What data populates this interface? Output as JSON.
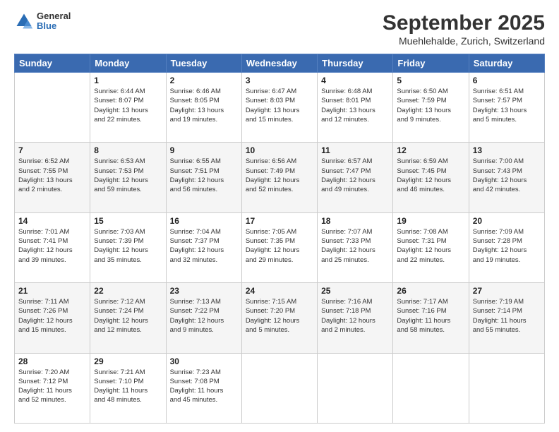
{
  "header": {
    "logo_general": "General",
    "logo_blue": "Blue",
    "title": "September 2025",
    "subtitle": "Muehlehalde, Zurich, Switzerland"
  },
  "days_of_week": [
    "Sunday",
    "Monday",
    "Tuesday",
    "Wednesday",
    "Thursday",
    "Friday",
    "Saturday"
  ],
  "weeks": [
    [
      {
        "day": "",
        "info": ""
      },
      {
        "day": "1",
        "info": "Sunrise: 6:44 AM\nSunset: 8:07 PM\nDaylight: 13 hours\nand 22 minutes."
      },
      {
        "day": "2",
        "info": "Sunrise: 6:46 AM\nSunset: 8:05 PM\nDaylight: 13 hours\nand 19 minutes."
      },
      {
        "day": "3",
        "info": "Sunrise: 6:47 AM\nSunset: 8:03 PM\nDaylight: 13 hours\nand 15 minutes."
      },
      {
        "day": "4",
        "info": "Sunrise: 6:48 AM\nSunset: 8:01 PM\nDaylight: 13 hours\nand 12 minutes."
      },
      {
        "day": "5",
        "info": "Sunrise: 6:50 AM\nSunset: 7:59 PM\nDaylight: 13 hours\nand 9 minutes."
      },
      {
        "day": "6",
        "info": "Sunrise: 6:51 AM\nSunset: 7:57 PM\nDaylight: 13 hours\nand 5 minutes."
      }
    ],
    [
      {
        "day": "7",
        "info": "Sunrise: 6:52 AM\nSunset: 7:55 PM\nDaylight: 13 hours\nand 2 minutes."
      },
      {
        "day": "8",
        "info": "Sunrise: 6:53 AM\nSunset: 7:53 PM\nDaylight: 12 hours\nand 59 minutes."
      },
      {
        "day": "9",
        "info": "Sunrise: 6:55 AM\nSunset: 7:51 PM\nDaylight: 12 hours\nand 56 minutes."
      },
      {
        "day": "10",
        "info": "Sunrise: 6:56 AM\nSunset: 7:49 PM\nDaylight: 12 hours\nand 52 minutes."
      },
      {
        "day": "11",
        "info": "Sunrise: 6:57 AM\nSunset: 7:47 PM\nDaylight: 12 hours\nand 49 minutes."
      },
      {
        "day": "12",
        "info": "Sunrise: 6:59 AM\nSunset: 7:45 PM\nDaylight: 12 hours\nand 46 minutes."
      },
      {
        "day": "13",
        "info": "Sunrise: 7:00 AM\nSunset: 7:43 PM\nDaylight: 12 hours\nand 42 minutes."
      }
    ],
    [
      {
        "day": "14",
        "info": "Sunrise: 7:01 AM\nSunset: 7:41 PM\nDaylight: 12 hours\nand 39 minutes."
      },
      {
        "day": "15",
        "info": "Sunrise: 7:03 AM\nSunset: 7:39 PM\nDaylight: 12 hours\nand 35 minutes."
      },
      {
        "day": "16",
        "info": "Sunrise: 7:04 AM\nSunset: 7:37 PM\nDaylight: 12 hours\nand 32 minutes."
      },
      {
        "day": "17",
        "info": "Sunrise: 7:05 AM\nSunset: 7:35 PM\nDaylight: 12 hours\nand 29 minutes."
      },
      {
        "day": "18",
        "info": "Sunrise: 7:07 AM\nSunset: 7:33 PM\nDaylight: 12 hours\nand 25 minutes."
      },
      {
        "day": "19",
        "info": "Sunrise: 7:08 AM\nSunset: 7:31 PM\nDaylight: 12 hours\nand 22 minutes."
      },
      {
        "day": "20",
        "info": "Sunrise: 7:09 AM\nSunset: 7:28 PM\nDaylight: 12 hours\nand 19 minutes."
      }
    ],
    [
      {
        "day": "21",
        "info": "Sunrise: 7:11 AM\nSunset: 7:26 PM\nDaylight: 12 hours\nand 15 minutes."
      },
      {
        "day": "22",
        "info": "Sunrise: 7:12 AM\nSunset: 7:24 PM\nDaylight: 12 hours\nand 12 minutes."
      },
      {
        "day": "23",
        "info": "Sunrise: 7:13 AM\nSunset: 7:22 PM\nDaylight: 12 hours\nand 9 minutes."
      },
      {
        "day": "24",
        "info": "Sunrise: 7:15 AM\nSunset: 7:20 PM\nDaylight: 12 hours\nand 5 minutes."
      },
      {
        "day": "25",
        "info": "Sunrise: 7:16 AM\nSunset: 7:18 PM\nDaylight: 12 hours\nand 2 minutes."
      },
      {
        "day": "26",
        "info": "Sunrise: 7:17 AM\nSunset: 7:16 PM\nDaylight: 11 hours\nand 58 minutes."
      },
      {
        "day": "27",
        "info": "Sunrise: 7:19 AM\nSunset: 7:14 PM\nDaylight: 11 hours\nand 55 minutes."
      }
    ],
    [
      {
        "day": "28",
        "info": "Sunrise: 7:20 AM\nSunset: 7:12 PM\nDaylight: 11 hours\nand 52 minutes."
      },
      {
        "day": "29",
        "info": "Sunrise: 7:21 AM\nSunset: 7:10 PM\nDaylight: 11 hours\nand 48 minutes."
      },
      {
        "day": "30",
        "info": "Sunrise: 7:23 AM\nSunset: 7:08 PM\nDaylight: 11 hours\nand 45 minutes."
      },
      {
        "day": "",
        "info": ""
      },
      {
        "day": "",
        "info": ""
      },
      {
        "day": "",
        "info": ""
      },
      {
        "day": "",
        "info": ""
      }
    ]
  ]
}
